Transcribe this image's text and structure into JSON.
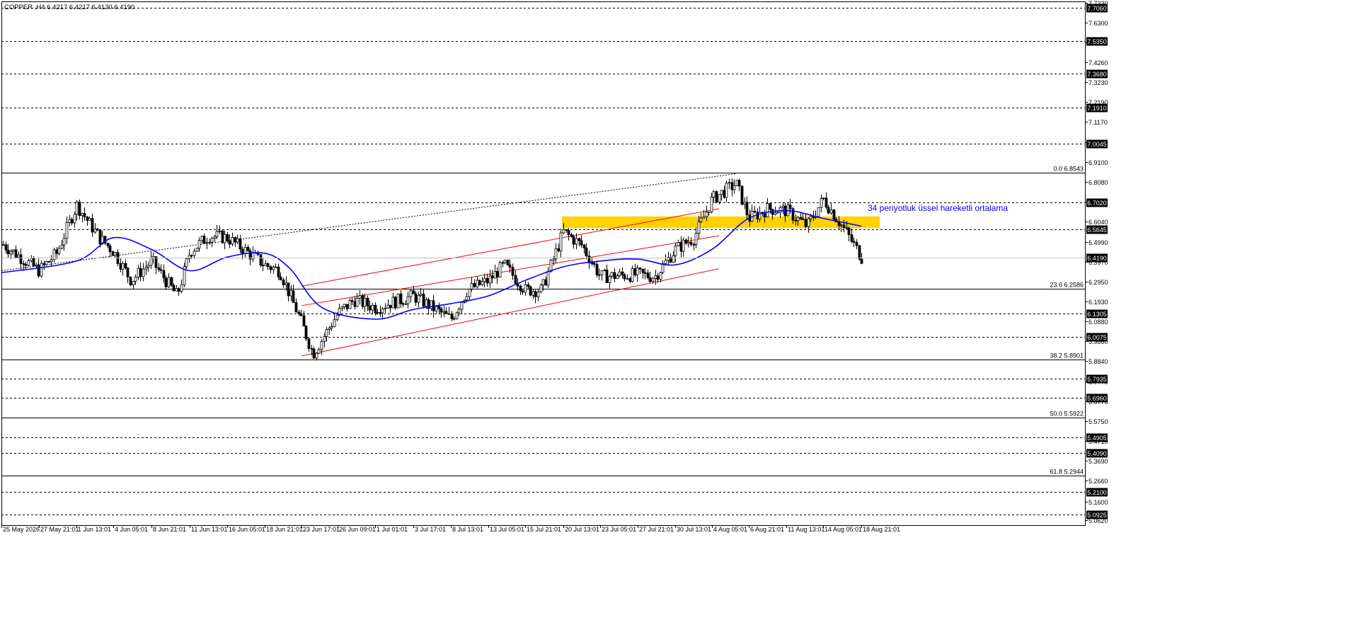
{
  "header": {
    "symbol_line": "COPPER ,H4  6.4217 6.4217 6.4130 6.4190"
  },
  "annotation": {
    "ema_label": "34 periyotluk üssel hareketli ortalama"
  },
  "colors": {
    "background": "#ffffff",
    "candle": "#000000",
    "ema": "#0000ff",
    "channel": "#ff0000",
    "zone": "#ffd200",
    "fib": "#000000",
    "price_label_bg": "#000000",
    "price_label_text": "#ffffff"
  },
  "chart_data": {
    "type": "candlestick",
    "symbol": "COPPER",
    "timeframe": "H4",
    "last_price": 6.419,
    "ylim": [
      5.048,
      7.74
    ],
    "y_ticks": [
      "7.7330",
      "7.6300",
      "7.5270",
      "7.4260",
      "7.3230",
      "7.2190",
      "7.1170",
      "7.0140",
      "6.9100",
      "6.8080",
      "6.7050",
      "6.6040",
      "6.4990",
      "6.3970",
      "6.2950",
      "6.1930",
      "6.0880",
      "5.9860",
      "5.8840",
      "5.7770",
      "5.6770",
      "5.5750",
      "5.4710",
      "5.3690",
      "5.2660",
      "5.1600",
      "5.0620"
    ],
    "x_ticks": [
      "25 May 2026",
      "27 May 21:01",
      "1 Jun 13:01",
      "4 Jun 05:01",
      "8 Jun 21:01",
      "11 Jun 13:01",
      "16 Jun 05:01",
      "18 Jun 21:01",
      "23 Jun 17:01",
      "26 Jun 09:01",
      "1 Jul 01:01",
      "3 Jul 17:01",
      "8 Jul 13:01",
      "13 Jul 05:01",
      "15 Jul 21:01",
      "20 Jul 13:01",
      "23 Jul 05:01",
      "27 Jul 21:01",
      "30 Jul 13:01",
      "4 Aug 05:01",
      "6 Aug 21:01",
      "11 Aug 13:01",
      "14 Aug 05:01",
      "18 Aug 21:01"
    ],
    "horizontal_levels": [
      "7.7060",
      "7.5350",
      "7.3680",
      "7.1910",
      "7.0045",
      "6.7020",
      "6.5645",
      "6.1305",
      "6.0075",
      "5.7935",
      "5.6960",
      "5.4905",
      "5.4090",
      "5.2100",
      "5.0925"
    ],
    "fibonacci_levels": [
      {
        "label": "0.0 6.8543",
        "price": 6.8543
      },
      {
        "label": "23.6 6.2586",
        "price": 6.2586
      },
      {
        "label": "38.2 5.8901",
        "price": 5.8901
      },
      {
        "label": "50.0 5.5922",
        "price": 5.5922
      },
      {
        "label": "61.8 5.2944",
        "price": 5.2944
      }
    ],
    "price_path": [
      {
        "t": "25 May 2026",
        "price": 6.49
      },
      {
        "t": "27 May 21:01",
        "price": 6.35
      },
      {
        "t": "29 May",
        "price": 6.44
      },
      {
        "t": "1 Jun 13:01",
        "price": 6.69
      },
      {
        "t": "3 Jun",
        "price": 6.52
      },
      {
        "t": "4 Jun 05:01",
        "price": 6.45
      },
      {
        "t": "6 Jun",
        "price": 6.3
      },
      {
        "t": "8 Jun 21:01",
        "price": 6.4
      },
      {
        "t": "10 Jun",
        "price": 6.22
      },
      {
        "t": "11 Jun 13:01",
        "price": 6.45
      },
      {
        "t": "13 Jun",
        "price": 6.53
      },
      {
        "t": "16 Jun 05:01",
        "price": 6.52
      },
      {
        "t": "18 Jun 21:01",
        "price": 6.38
      },
      {
        "t": "20 Jun",
        "price": 6.35
      },
      {
        "t": "23 Jun 17:01",
        "price": 6.08
      },
      {
        "t": "24 Jun",
        "price": 5.92
      },
      {
        "t": "26 Jun 09:01",
        "price": 6.13
      },
      {
        "t": "28 Jun",
        "price": 6.2
      },
      {
        "t": "1 Jul 01:01",
        "price": 6.16
      },
      {
        "t": "3 Jul 17:01",
        "price": 6.22
      },
      {
        "t": "8 Jul 13:01",
        "price": 6.1
      },
      {
        "t": "10 Jul",
        "price": 6.25
      },
      {
        "t": "13 Jul 05:01",
        "price": 6.3
      },
      {
        "t": "14 Jul",
        "price": 6.38
      },
      {
        "t": "15 Jul 21:01",
        "price": 6.25
      },
      {
        "t": "17 Jul",
        "price": 6.25
      },
      {
        "t": "20 Jul 13:01",
        "price": 6.55
      },
      {
        "t": "22 Jul",
        "price": 6.48
      },
      {
        "t": "23 Jul 05:01",
        "price": 6.32
      },
      {
        "t": "27 Jul 21:01",
        "price": 6.33
      },
      {
        "t": "29 Jul",
        "price": 6.32
      },
      {
        "t": "30 Jul 13:01",
        "price": 6.46
      },
      {
        "t": "1 Aug",
        "price": 6.52
      },
      {
        "t": "4 Aug 05:01",
        "price": 6.72
      },
      {
        "t": "5 Aug",
        "price": 6.8
      },
      {
        "t": "6 Aug 21:01",
        "price": 6.62
      },
      {
        "t": "10 Aug",
        "price": 6.67
      },
      {
        "t": "11 Aug 13:01",
        "price": 6.66
      },
      {
        "t": "13 Aug",
        "price": 6.58
      },
      {
        "t": "14 Aug 05:01",
        "price": 6.72
      },
      {
        "t": "17 Aug",
        "price": 6.55
      },
      {
        "t": "18 Aug 21:01",
        "price": 6.419
      }
    ],
    "ema_path": [
      {
        "t": "25 May 2026",
        "price": 6.34
      },
      {
        "t": "1 Jun 13:01",
        "price": 6.4
      },
      {
        "t": "4 Jun 05:01",
        "price": 6.52
      },
      {
        "t": "8 Jun 21:01",
        "price": 6.46
      },
      {
        "t": "11 Jun 13:01",
        "price": 6.35
      },
      {
        "t": "16 Jun 05:01",
        "price": 6.42
      },
      {
        "t": "18 Jun 21:01",
        "price": 6.44
      },
      {
        "t": "22 Jun",
        "price": 6.36
      },
      {
        "t": "25 Jun",
        "price": 6.16
      },
      {
        "t": "1 Jul 01:01",
        "price": 6.1
      },
      {
        "t": "3 Jul 17:01",
        "price": 6.15
      },
      {
        "t": "8 Jul 13:01",
        "price": 6.18
      },
      {
        "t": "13 Jul 05:01",
        "price": 6.22
      },
      {
        "t": "15 Jul 21:01",
        "price": 6.3
      },
      {
        "t": "20 Jul 13:01",
        "price": 6.37
      },
      {
        "t": "23 Jul 05:01",
        "price": 6.4
      },
      {
        "t": "27 Jul 21:01",
        "price": 6.41
      },
      {
        "t": "30 Jul 13:01",
        "price": 6.38
      },
      {
        "t": "4 Aug 05:01",
        "price": 6.46
      },
      {
        "t": "6 Aug 21:01",
        "price": 6.62
      },
      {
        "t": "11 Aug 13:01",
        "price": 6.66
      },
      {
        "t": "14 Aug 05:01",
        "price": 6.62
      },
      {
        "t": "18 Aug 21:01",
        "price": 6.58
      }
    ],
    "channel": {
      "upper": [
        {
          "t": "23 Jun 17:01",
          "price": 6.27
        },
        {
          "t": "4 Aug 05:01",
          "price": 6.67
        }
      ],
      "middle": [
        {
          "t": "23 Jun 17:01",
          "price": 6.17
        },
        {
          "t": "4 Aug 05:01",
          "price": 6.53
        }
      ],
      "lower": [
        {
          "t": "23 Jun 17:01",
          "price": 5.91
        },
        {
          "t": "4 Aug 05:01",
          "price": 6.36
        }
      ]
    },
    "resistance_zone": {
      "from": "20 Jul 13:01",
      "to": "18 Aug 21:01",
      "low": 6.57,
      "high": 6.63
    },
    "trendline_dotted": [
      {
        "t": "25 May 2026",
        "price": 6.35
      },
      {
        "t": "5 Aug",
        "price": 6.85
      }
    ]
  }
}
